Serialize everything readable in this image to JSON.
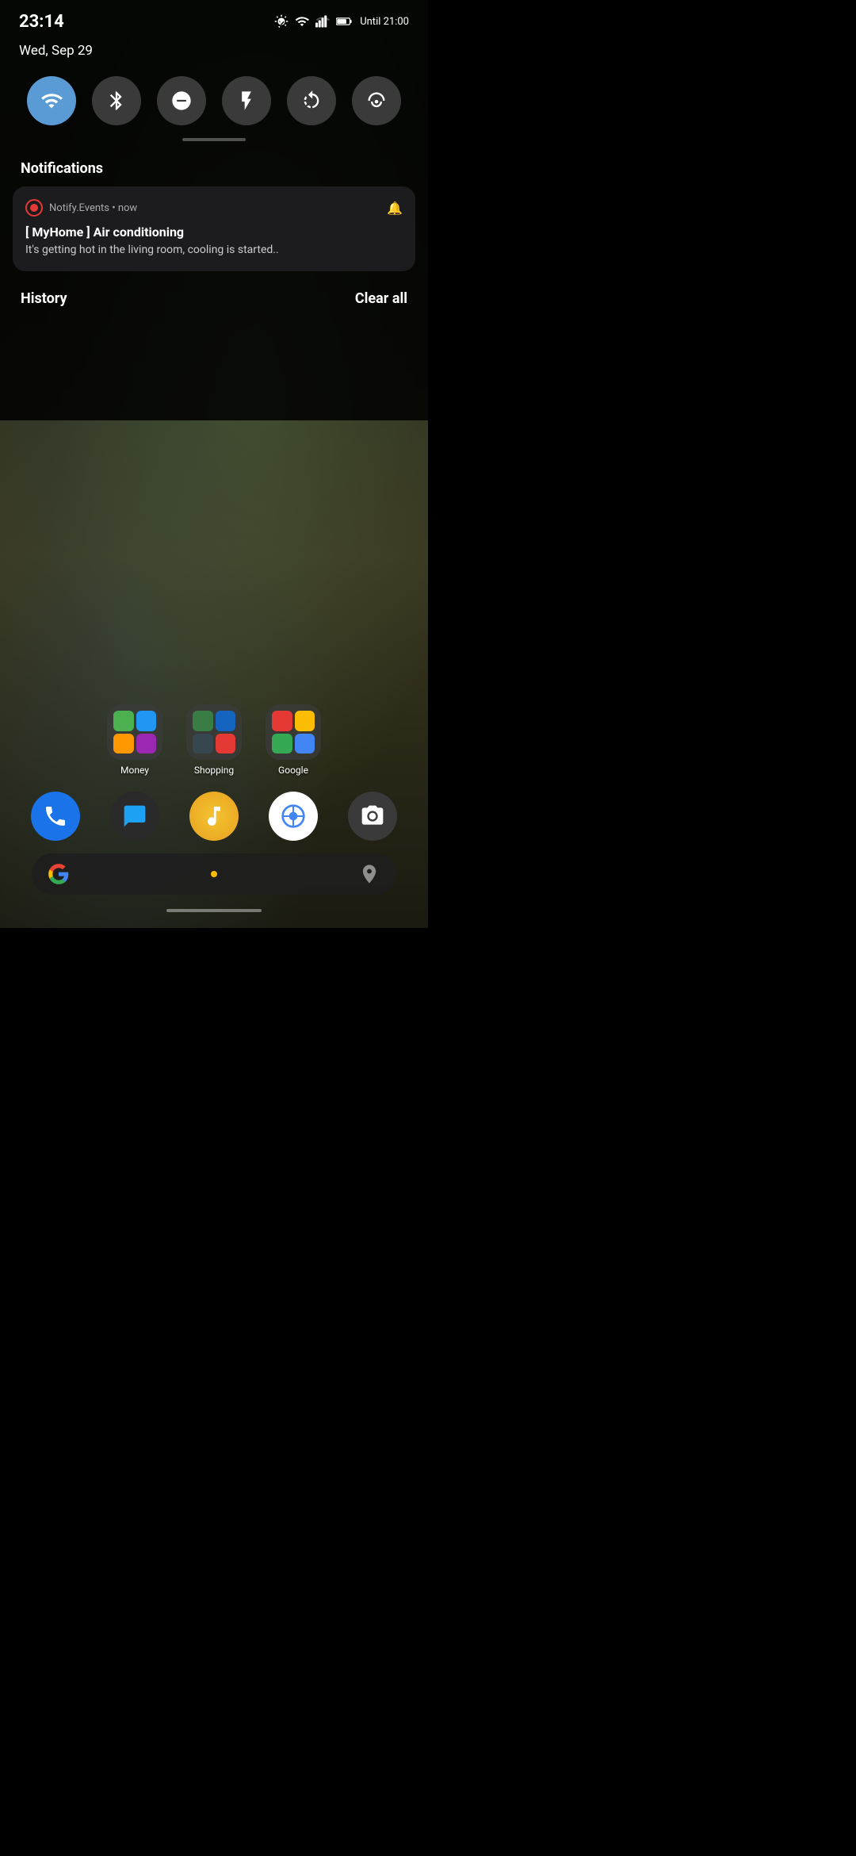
{
  "statusBar": {
    "time": "23:14",
    "date": "Wed, Sep 29",
    "battery_label": "Until 21:00"
  },
  "quickSettings": {
    "buttons": [
      {
        "id": "wifi",
        "label": "Wi-Fi",
        "active": true
      },
      {
        "id": "bluetooth",
        "label": "Bluetooth",
        "active": false
      },
      {
        "id": "dnd",
        "label": "Do Not Disturb",
        "active": false
      },
      {
        "id": "flashlight",
        "label": "Flashlight",
        "active": false
      },
      {
        "id": "autorotate",
        "label": "Auto Rotate",
        "active": false
      },
      {
        "id": "hotspot",
        "label": "Hotspot",
        "active": false
      }
    ]
  },
  "notifications": {
    "section_label": "Notifications",
    "items": [
      {
        "app_name": "Notify.Events",
        "timestamp": "now",
        "title": "[ MyHome ] Air conditioning",
        "body": "It's getting hot in the living room, cooling is started.."
      }
    ]
  },
  "history": {
    "label": "History",
    "clear_all_label": "Clear all"
  },
  "dock": {
    "apps": [
      {
        "name": "Phone",
        "icon": "phone-icon"
      },
      {
        "name": "Messages",
        "icon": "messages-icon"
      },
      {
        "name": "Music",
        "icon": "music-icon"
      },
      {
        "name": "Browser",
        "icon": "browser-icon"
      },
      {
        "name": "Camera",
        "icon": "camera-icon"
      }
    ]
  },
  "folders": [
    {
      "label": "Money"
    },
    {
      "label": "Shopping"
    },
    {
      "label": "Google"
    }
  ]
}
